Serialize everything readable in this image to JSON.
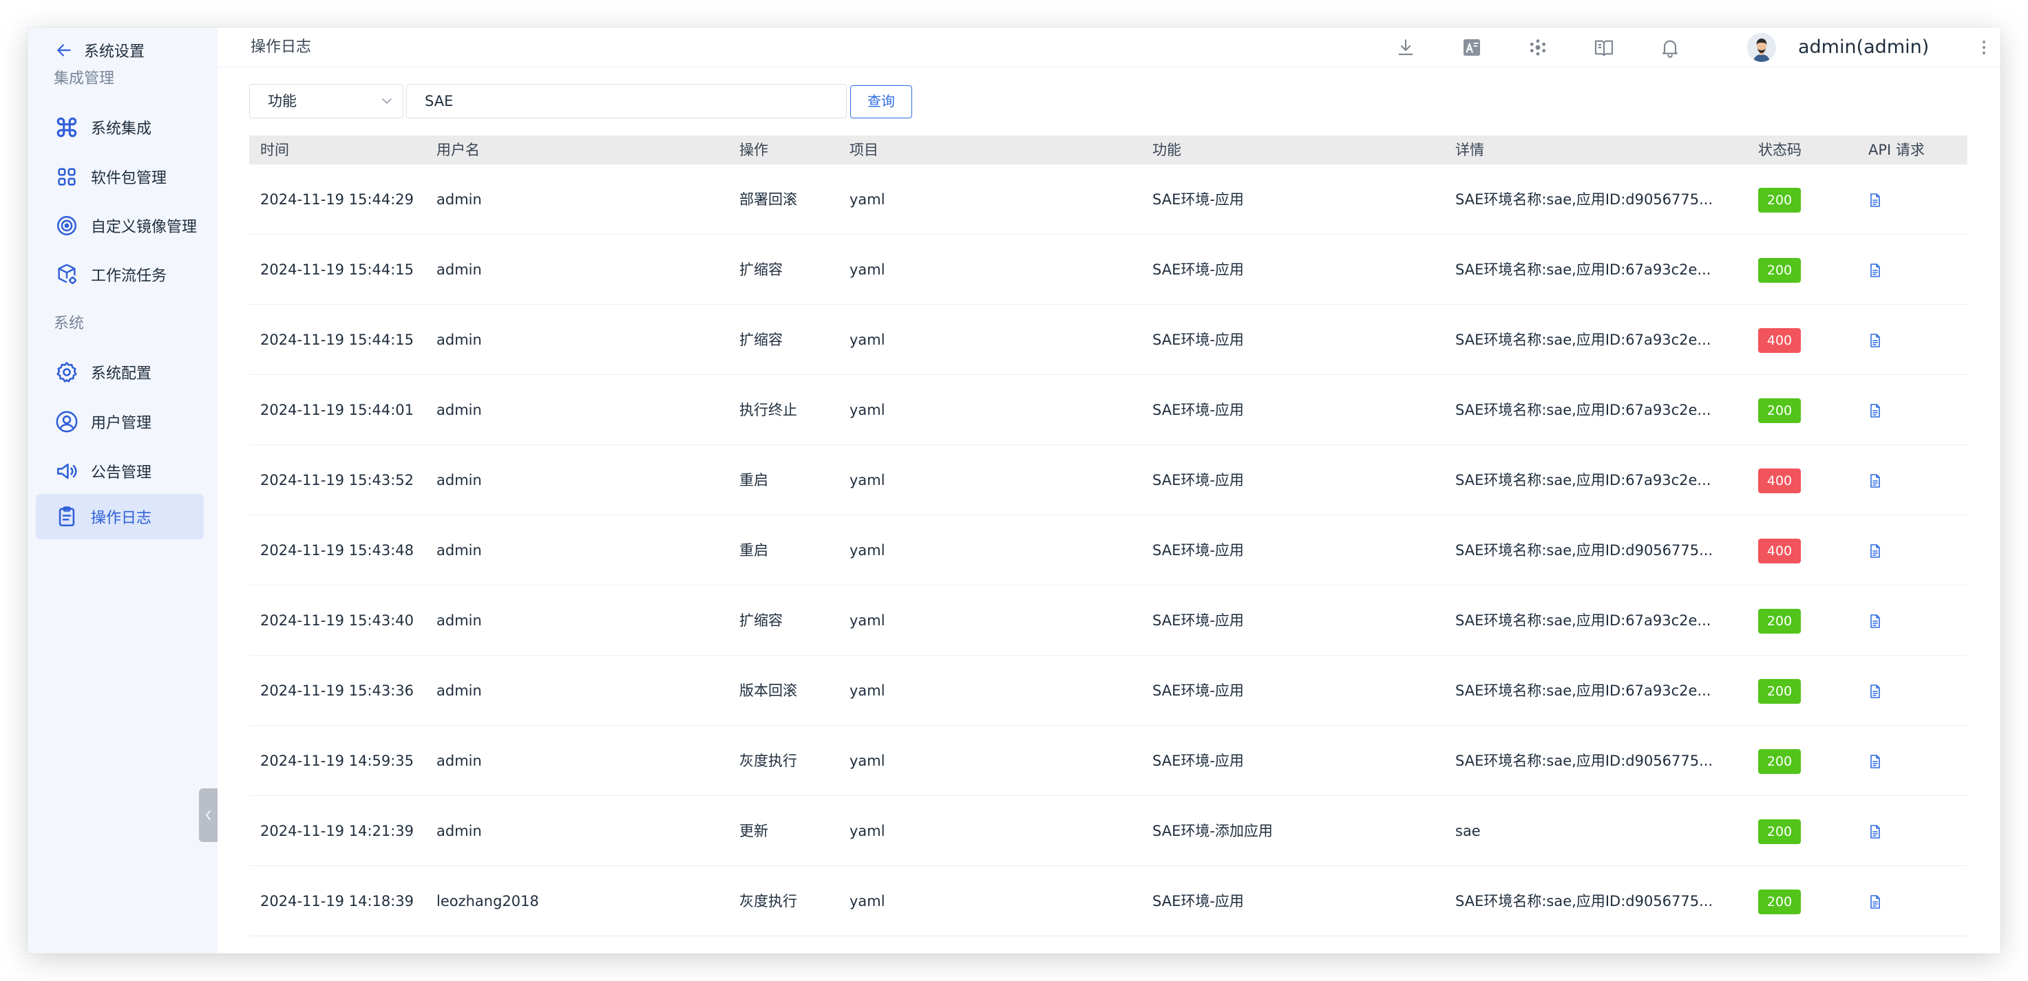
{
  "sidebar": {
    "back_label": "系统设置",
    "section_integration": "集成管理",
    "section_system": "系统",
    "items": [
      {
        "label": "系统集成",
        "icon": "command-icon"
      },
      {
        "label": "软件包管理",
        "icon": "grid-icon"
      },
      {
        "label": "自定义镜像管理",
        "icon": "target-icon"
      },
      {
        "label": "工作流任务",
        "icon": "cube-gear-icon"
      },
      {
        "label": "系统配置",
        "icon": "gear-icon"
      },
      {
        "label": "用户管理",
        "icon": "user-circle-icon"
      },
      {
        "label": "公告管理",
        "icon": "speaker-icon"
      },
      {
        "label": "操作日志",
        "icon": "clipboard-icon",
        "active": true
      }
    ]
  },
  "header": {
    "title": "操作日志",
    "username": "admin(admin)"
  },
  "filter": {
    "field_selected": "功能",
    "query_value": "SAE",
    "query_button": "查询"
  },
  "table": {
    "columns": [
      "时间",
      "用户名",
      "操作",
      "项目",
      "功能",
      "详情",
      "状态码",
      "API 请求"
    ],
    "rows": [
      {
        "time": "2024-11-19 15:44:29",
        "user": "admin",
        "op": "部署回滚",
        "project": "yaml",
        "func": "SAE环境-应用",
        "detail": "SAE环境名称:sae,应用ID:d9056775...",
        "status": "200"
      },
      {
        "time": "2024-11-19 15:44:15",
        "user": "admin",
        "op": "扩缩容",
        "project": "yaml",
        "func": "SAE环境-应用",
        "detail": "SAE环境名称:sae,应用ID:67a93c2e...",
        "status": "200"
      },
      {
        "time": "2024-11-19 15:44:15",
        "user": "admin",
        "op": "扩缩容",
        "project": "yaml",
        "func": "SAE环境-应用",
        "detail": "SAE环境名称:sae,应用ID:67a93c2e...",
        "status": "400"
      },
      {
        "time": "2024-11-19 15:44:01",
        "user": "admin",
        "op": "执行终止",
        "project": "yaml",
        "func": "SAE环境-应用",
        "detail": "SAE环境名称:sae,应用ID:67a93c2e...",
        "status": "200"
      },
      {
        "time": "2024-11-19 15:43:52",
        "user": "admin",
        "op": "重启",
        "project": "yaml",
        "func": "SAE环境-应用",
        "detail": "SAE环境名称:sae,应用ID:67a93c2e...",
        "status": "400"
      },
      {
        "time": "2024-11-19 15:43:48",
        "user": "admin",
        "op": "重启",
        "project": "yaml",
        "func": "SAE环境-应用",
        "detail": "SAE环境名称:sae,应用ID:d9056775...",
        "status": "400"
      },
      {
        "time": "2024-11-19 15:43:40",
        "user": "admin",
        "op": "扩缩容",
        "project": "yaml",
        "func": "SAE环境-应用",
        "detail": "SAE环境名称:sae,应用ID:67a93c2e...",
        "status": "200"
      },
      {
        "time": "2024-11-19 15:43:36",
        "user": "admin",
        "op": "版本回滚",
        "project": "yaml",
        "func": "SAE环境-应用",
        "detail": "SAE环境名称:sae,应用ID:67a93c2e...",
        "status": "200"
      },
      {
        "time": "2024-11-19 14:59:35",
        "user": "admin",
        "op": "灰度执行",
        "project": "yaml",
        "func": "SAE环境-应用",
        "detail": "SAE环境名称:sae,应用ID:d9056775...",
        "status": "200"
      },
      {
        "time": "2024-11-19 14:21:39",
        "user": "admin",
        "op": "更新",
        "project": "yaml",
        "func": "SAE环境-添加应用",
        "detail": "sae",
        "status": "200"
      },
      {
        "time": "2024-11-19 14:18:39",
        "user": "leozhang2018",
        "op": "灰度执行",
        "project": "yaml",
        "func": "SAE环境-应用",
        "detail": "SAE环境名称:sae,应用ID:d9056775...",
        "status": "200"
      }
    ]
  },
  "colors": {
    "accent": "#2f6be0",
    "status_ok": "#52c41a",
    "status_error": "#f2545b",
    "sidebar_bg": "#f3f6fc",
    "active_bg": "#dde6fb"
  }
}
